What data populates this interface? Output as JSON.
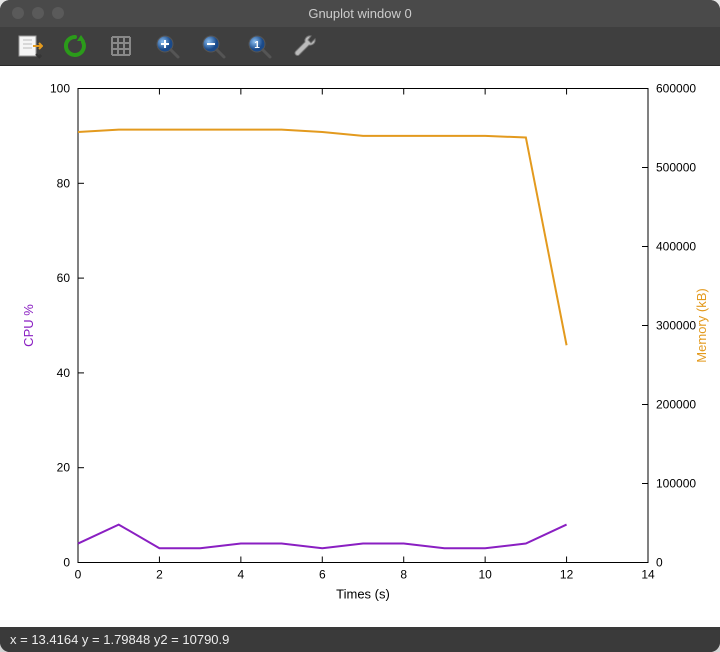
{
  "window": {
    "title": "Gnuplot window 0"
  },
  "toolbar": {
    "items": [
      {
        "name": "export",
        "label": "Export"
      },
      {
        "name": "reload",
        "label": "Reload"
      },
      {
        "name": "grid",
        "label": "Grid"
      },
      {
        "name": "zoom-in",
        "label": "Zoom In"
      },
      {
        "name": "zoom-out",
        "label": "Zoom Out"
      },
      {
        "name": "zoom-reset",
        "label": "Zoom Reset"
      },
      {
        "name": "options",
        "label": "Options"
      }
    ]
  },
  "status": {
    "text": "x = 13.4164 y = 1.79848 y2 = 10790.9"
  },
  "chart_data": {
    "type": "line",
    "xlabel": "Times (s)",
    "ylabel_left": "CPU %",
    "ylabel_right": "Memory (kB)",
    "xlim": [
      0,
      14
    ],
    "xticks": [
      0,
      2,
      4,
      6,
      8,
      10,
      12,
      14
    ],
    "ylim_left": [
      0,
      100
    ],
    "yticks_left": [
      0,
      20,
      40,
      60,
      80,
      100
    ],
    "ylim_right": [
      0,
      600000
    ],
    "yticks_right": [
      0,
      100000,
      200000,
      300000,
      400000,
      500000,
      600000
    ],
    "x": [
      0,
      1,
      2,
      3,
      4,
      5,
      6,
      7,
      8,
      9,
      10,
      11,
      12
    ],
    "series": [
      {
        "name": "CPU %",
        "axis": "left",
        "color": "#8a1fc2",
        "values": [
          4,
          8,
          3,
          3,
          4,
          4,
          3,
          4,
          4,
          3,
          3,
          4,
          8
        ]
      },
      {
        "name": "Memory (kB)",
        "axis": "right",
        "color": "#e39a1e",
        "values": [
          545000,
          548000,
          548000,
          548000,
          548000,
          548000,
          545000,
          540000,
          540000,
          540000,
          540000,
          538000,
          275000
        ]
      }
    ]
  }
}
